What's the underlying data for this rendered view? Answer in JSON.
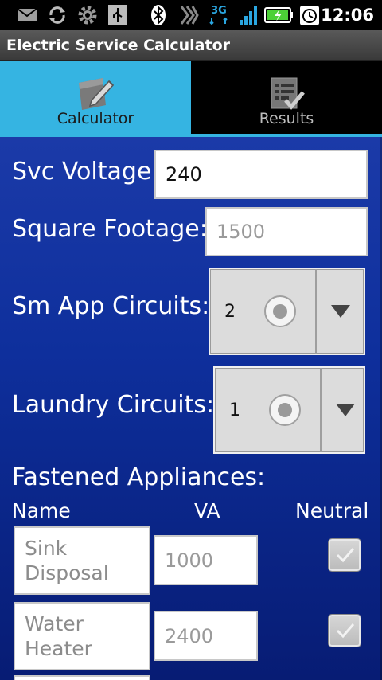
{
  "status_bar": {
    "time": "12:06",
    "icons": [
      "gmail-icon",
      "sync-icon",
      "settings-icon",
      "usb-icon",
      "bluetooth-icon",
      "signal-flow-icon",
      "3g-icon",
      "signal-bars-icon",
      "battery-charging-icon",
      "alarm-clock-icon"
    ],
    "network_label": "3G"
  },
  "app": {
    "title": "Electric Service Calculator"
  },
  "tabs": [
    {
      "label": "Calculator",
      "icon": "calculator-edit-icon",
      "active": true
    },
    {
      "label": "Results",
      "icon": "results-checklist-icon",
      "active": false
    }
  ],
  "form": {
    "svc_voltage": {
      "label": "Svc Voltage:",
      "value": "240"
    },
    "square_footage": {
      "label": "Square Footage:",
      "placeholder": "1500"
    },
    "sm_app_circuits": {
      "label": "Sm App Circuits:",
      "value": "2"
    },
    "laundry_circuits": {
      "label": "Laundry Circuits:",
      "value": "1"
    }
  },
  "appliances": {
    "heading": "Fastened Appliances:",
    "columns": {
      "name": "Name",
      "va": "VA",
      "neutral": "Neutral"
    },
    "rows": [
      {
        "name": "Sink\nDisposal",
        "va": "1000",
        "neutral": true
      },
      {
        "name": "Water\nHeater",
        "va": "2400",
        "neutral": true
      }
    ]
  },
  "colors": {
    "accent_tab": "#35b4e2",
    "background_top": "#1b3aa8",
    "background_bottom": "#071c74"
  }
}
